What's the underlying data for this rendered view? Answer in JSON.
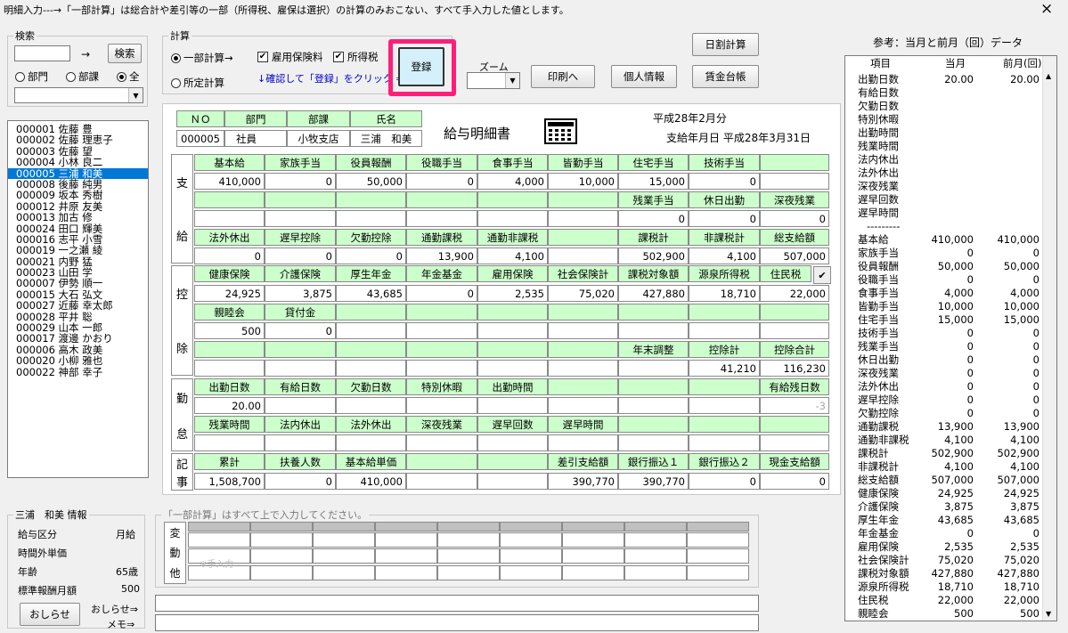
{
  "top_note": "明細入力---→「一部計算」は総合計や差引等の一部（所得税、雇保は選択）の計算のみおこない、すべて手入力した値とします。",
  "close_icon": "×",
  "search": {
    "legend": "検索",
    "arrow": "→",
    "button": "検索",
    "radio_dept": "部門",
    "radio_section": "部課",
    "radio_all": "全",
    "input_value": "",
    "select_value": ""
  },
  "employees": [
    "000001 佐藤 豊",
    "000002 佐藤 理恵子",
    "000003 佐藤 望",
    "000004 小林 良二",
    "000005 三浦 和美",
    "000008 後藤 純男",
    "000009 坂本 秀樹",
    "000012 井原 友美",
    "000013 加古 修",
    "000024 田口 輝美",
    "000016 志平 小雪",
    "000019 一之瀬 綾",
    "000021 内野 猛",
    "000023 山田 学",
    "000007 伊勢 順一",
    "000015 大石 弘文",
    "000027 近藤 幸太郎",
    "000028 平井 聡",
    "000029 山本 一郎",
    "000017 渡邊 かおり",
    "000006 高木 政美",
    "000020 小柳 雅也",
    "000022 神部 幸子"
  ],
  "calc": {
    "legend": "計算",
    "radio_partial": "一部計算→",
    "radio_full": "所定計算",
    "chk_employment": "雇用保険料",
    "chk_income": "所得税",
    "hint": "↓確認して「登録」をクリック ⇒",
    "register": "登録"
  },
  "zoom": {
    "label": "ズーム",
    "value": ""
  },
  "buttons": {
    "print": "印刷へ",
    "personal": "個人情報",
    "ledger": "賃金台帳",
    "daily": "日割計算"
  },
  "slip": {
    "no_h": "ＮＯ",
    "dept_h": "部門",
    "sect_h": "部課",
    "name_h": "氏名",
    "no": "000005",
    "dept": "社員",
    "sect": "小牧支店",
    "name": "三浦　和美",
    "title": "給与明細書",
    "calc_icon": "calculator-icon",
    "period": "平成28年2月分",
    "paydate": "支給年月日 平成28年3月31日",
    "sec_pay1": "支",
    "sec_pay2": "給",
    "sec_ded1": "控",
    "sec_ded2": "除",
    "sec_att1": "勤",
    "sec_att2": "怠",
    "sec_rec1": "記",
    "sec_rec2": "事",
    "pay_h1": [
      "基本給",
      "家族手当",
      "役員報酬",
      "役職手当",
      "食事手当",
      "皆勤手当",
      "住宅手当",
      "技術手当",
      ""
    ],
    "pay_v1": [
      "410,000",
      "0",
      "50,000",
      "0",
      "4,000",
      "10,000",
      "15,000",
      "0",
      ""
    ],
    "pay_h2": [
      "",
      "",
      "",
      "",
      "",
      "",
      "残業手当",
      "休日出勤",
      "深夜残業"
    ],
    "pay_v2": [
      "",
      "",
      "",
      "",
      "",
      "",
      "0",
      "0",
      "0"
    ],
    "pay_h3": [
      "法外休出",
      "遅早控除",
      "欠勤控除",
      "通勤課税",
      "通勤非課税",
      "",
      "課税計",
      "非課税計",
      "総支給額"
    ],
    "pay_v3": [
      "0",
      "0",
      "0",
      "13,900",
      "4,100",
      "",
      "502,900",
      "4,100",
      "507,000"
    ],
    "ded_h1": [
      "健康保険",
      "介護保険",
      "厚生年金",
      "年金基金",
      "雇用保険",
      "社会保険計",
      "課税対象額",
      "源泉所得税",
      "住民税"
    ],
    "ded_v1": [
      "24,925",
      "3,875",
      "43,685",
      "0",
      "2,535",
      "75,020",
      "427,880",
      "18,710",
      "22,000"
    ],
    "ded_h2": [
      "親睦会",
      "貸付金",
      "",
      "",
      "",
      "",
      "",
      "",
      ""
    ],
    "ded_v2": [
      "500",
      "0",
      "",
      "",
      "",
      "",
      "",
      "",
      ""
    ],
    "ded_h3": [
      "",
      "",
      "",
      "",
      "",
      "",
      "年末調整",
      "控除計",
      "控除合計"
    ],
    "ded_v3": [
      "",
      "",
      "",
      "",
      "",
      "",
      "",
      "41,210",
      "116,230"
    ],
    "att_h1": [
      "出勤日数",
      "有給日数",
      "欠勤日数",
      "特別休暇",
      "出勤時間",
      "",
      "",
      "",
      "有給残日数"
    ],
    "att_v1": [
      "20.00",
      "",
      "",
      "",
      "",
      "",
      "",
      "",
      "-3"
    ],
    "att_h2": [
      "残業時間",
      "法内休出",
      "法外休出",
      "深夜残業",
      "遅早回数",
      "遅早時間",
      "",
      "",
      ""
    ],
    "att_v2": [
      "",
      "",
      "",
      "",
      "",
      "",
      "",
      "",
      ""
    ],
    "rec_h": [
      "累計",
      "扶養人数",
      "基本給単価",
      "",
      "",
      "差引支給額",
      "銀行振込１",
      "銀行振込２",
      "現金支給額"
    ],
    "rec_v": [
      "1,508,700",
      "0",
      "410,000",
      "",
      "",
      "390,770",
      "390,770",
      "0",
      "0"
    ],
    "check_mark": "✔"
  },
  "person": {
    "legend": "三浦　和美 情報",
    "r1k": "給与区分",
    "r1v": "月給",
    "r2k": "時間外単価",
    "r2v": "",
    "r3k": "年齢",
    "r3v": "65歳",
    "r4k": "標準報酬月額",
    "r4v": "500",
    "notice_btn": "おしらせ",
    "notice_link": "おしらせ⇒",
    "memo_link": "メモ⇒"
  },
  "variable": {
    "legend": "「一部計算」はすべて上で入力してください。",
    "label1": "変",
    "label2": "動",
    "label3": "他",
    "input_hint": "※手入力"
  },
  "ref": {
    "title": "参考：当月と前月（回）データ",
    "h_item": "項目",
    "h_cur": "当月",
    "h_prev": "前月(回)",
    "rows": [
      [
        "出勤日数",
        "20.00",
        "20.00"
      ],
      [
        "有給日数",
        "",
        ""
      ],
      [
        "欠勤日数",
        "",
        ""
      ],
      [
        "特別休暇",
        "",
        ""
      ],
      [
        "出勤時間",
        "",
        ""
      ],
      [
        "残業時間",
        "",
        ""
      ],
      [
        "法内休出",
        "",
        ""
      ],
      [
        "法外休出",
        "",
        ""
      ],
      [
        "深夜残業",
        "",
        ""
      ],
      [
        "遅早回数",
        "",
        ""
      ],
      [
        "遅早時間",
        "",
        ""
      ],
      [
        "---------",
        "",
        ""
      ],
      [
        "基本給",
        "410,000",
        "410,000"
      ],
      [
        "家族手当",
        "0",
        "0"
      ],
      [
        "役員報酬",
        "50,000",
        "50,000"
      ],
      [
        "役職手当",
        "0",
        "0"
      ],
      [
        "食事手当",
        "4,000",
        "4,000"
      ],
      [
        "皆勤手当",
        "10,000",
        "10,000"
      ],
      [
        "住宅手当",
        "15,000",
        "15,000"
      ],
      [
        "技術手当",
        "0",
        "0"
      ],
      [
        "残業手当",
        "0",
        "0"
      ],
      [
        "休日出勤",
        "0",
        "0"
      ],
      [
        "深夜残業",
        "0",
        "0"
      ],
      [
        "法外休出",
        "0",
        "0"
      ],
      [
        "遅早控除",
        "0",
        "0"
      ],
      [
        "欠勤控除",
        "0",
        "0"
      ],
      [
        "通勤課税",
        "13,900",
        "13,900"
      ],
      [
        "通勤非課税",
        "4,100",
        "4,100"
      ],
      [
        "課税計",
        "502,900",
        "502,900"
      ],
      [
        "非課税計",
        "4,100",
        "4,100"
      ],
      [
        "総支給額",
        "507,000",
        "507,000"
      ],
      [
        "健康保険",
        "24,925",
        "24,925"
      ],
      [
        "介護保険",
        "3,875",
        "3,875"
      ],
      [
        "厚生年金",
        "43,685",
        "43,685"
      ],
      [
        "年金基金",
        "0",
        "0"
      ],
      [
        "雇用保険",
        "2,535",
        "2,535"
      ],
      [
        "社会保険計",
        "75,020",
        "75,020"
      ],
      [
        "課税対象額",
        "427,880",
        "427,880"
      ],
      [
        "源泉所得税",
        "18,710",
        "18,710"
      ],
      [
        "住民税",
        "22,000",
        "22,000"
      ],
      [
        "親睦会",
        "500",
        "500"
      ]
    ]
  }
}
